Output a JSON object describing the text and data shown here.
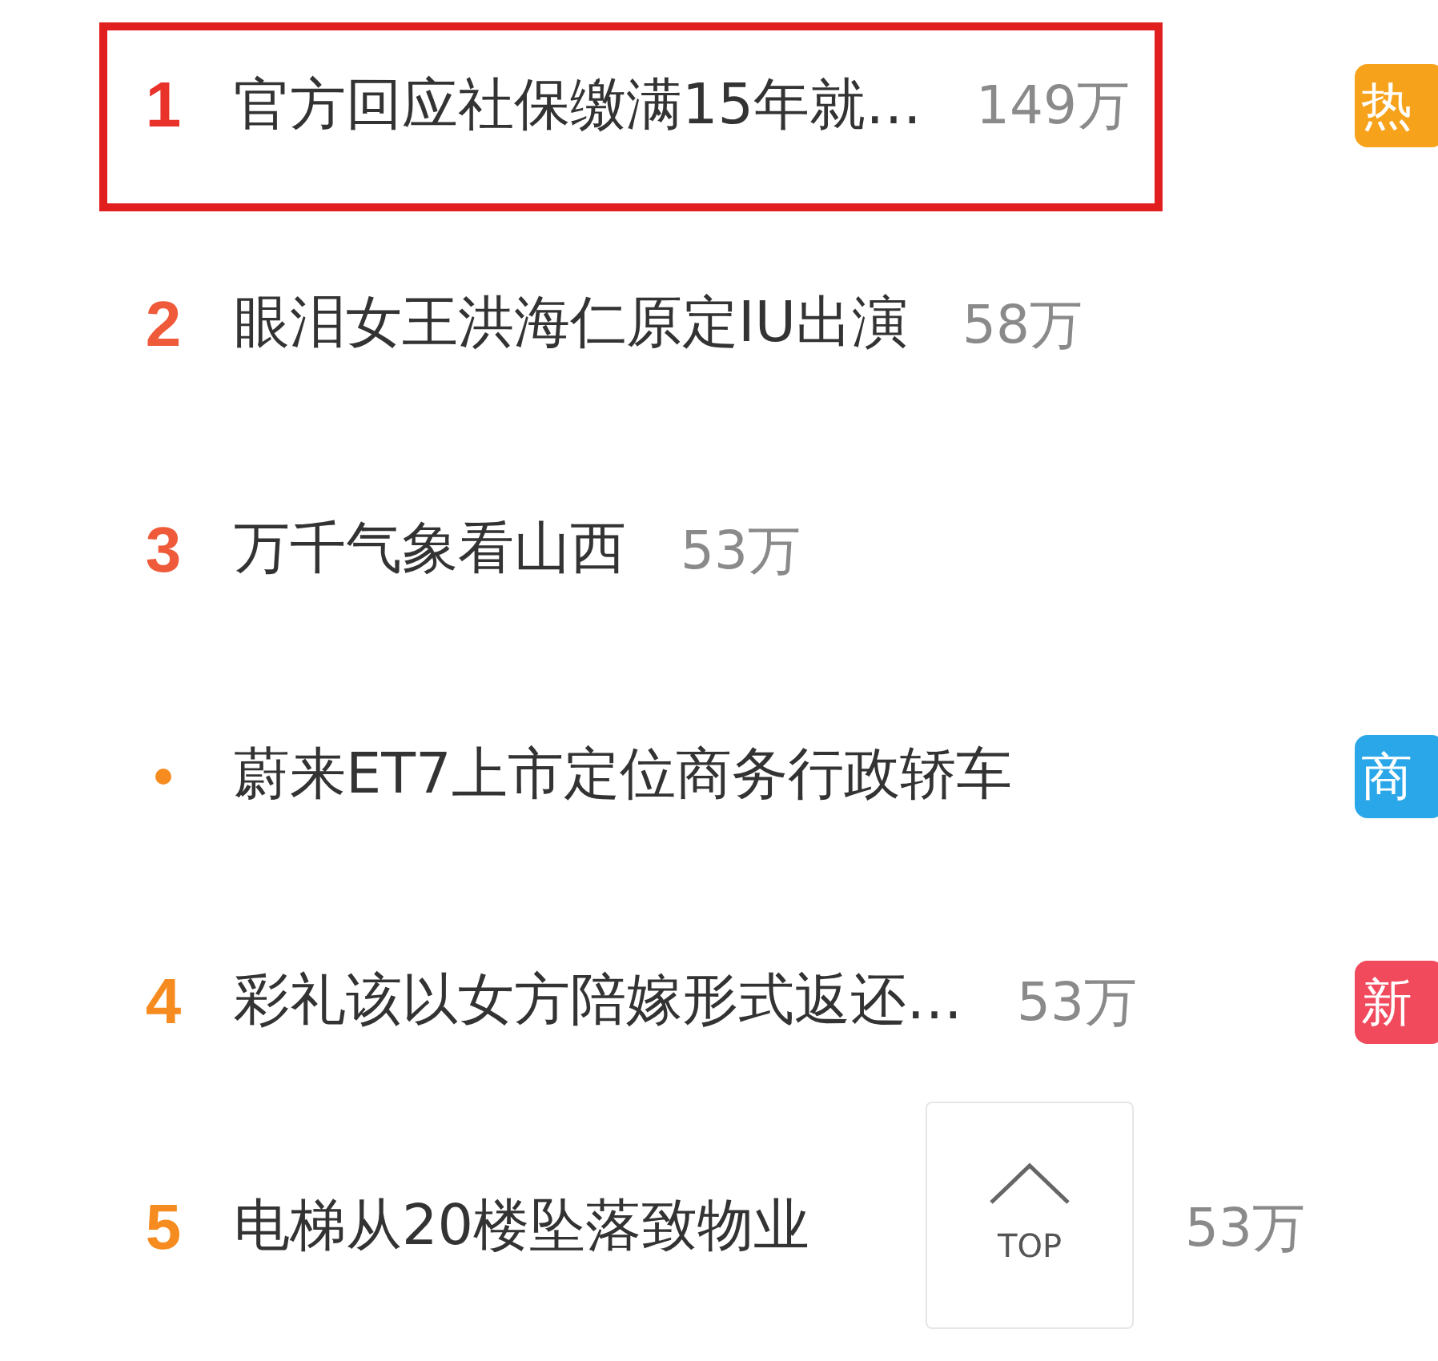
{
  "items": [
    {
      "kind": "ranked",
      "rank": "1",
      "title": "官方回应社保缴满15年就…",
      "count": "149万",
      "badge": {
        "text": "热",
        "color": "#f7a21b"
      },
      "highlighted": true
    },
    {
      "kind": "ranked",
      "rank": "2",
      "title": "眼泪女王洪海仁原定IU出演",
      "count": "58万",
      "highlighted": false
    },
    {
      "kind": "ranked",
      "rank": "3",
      "title": "万千气象看山西",
      "count": "53万",
      "highlighted": false
    },
    {
      "kind": "promoted",
      "title": "蔚来ET7上市定位商务行政轿车",
      "badge": {
        "text": "商",
        "color": "#2aa7e8"
      },
      "highlighted": false
    },
    {
      "kind": "ranked",
      "rank": "4",
      "title": "彩礼该以女方陪嫁形式返还…",
      "count": "53万",
      "badge": {
        "text": "新",
        "color": "#f04a5c"
      },
      "highlighted": false
    },
    {
      "kind": "ranked",
      "rank": "5",
      "title": "电梯从20楼坠落致物业",
      "count": "53万",
      "highlighted": false
    }
  ],
  "top_button": {
    "label": "TOP"
  }
}
